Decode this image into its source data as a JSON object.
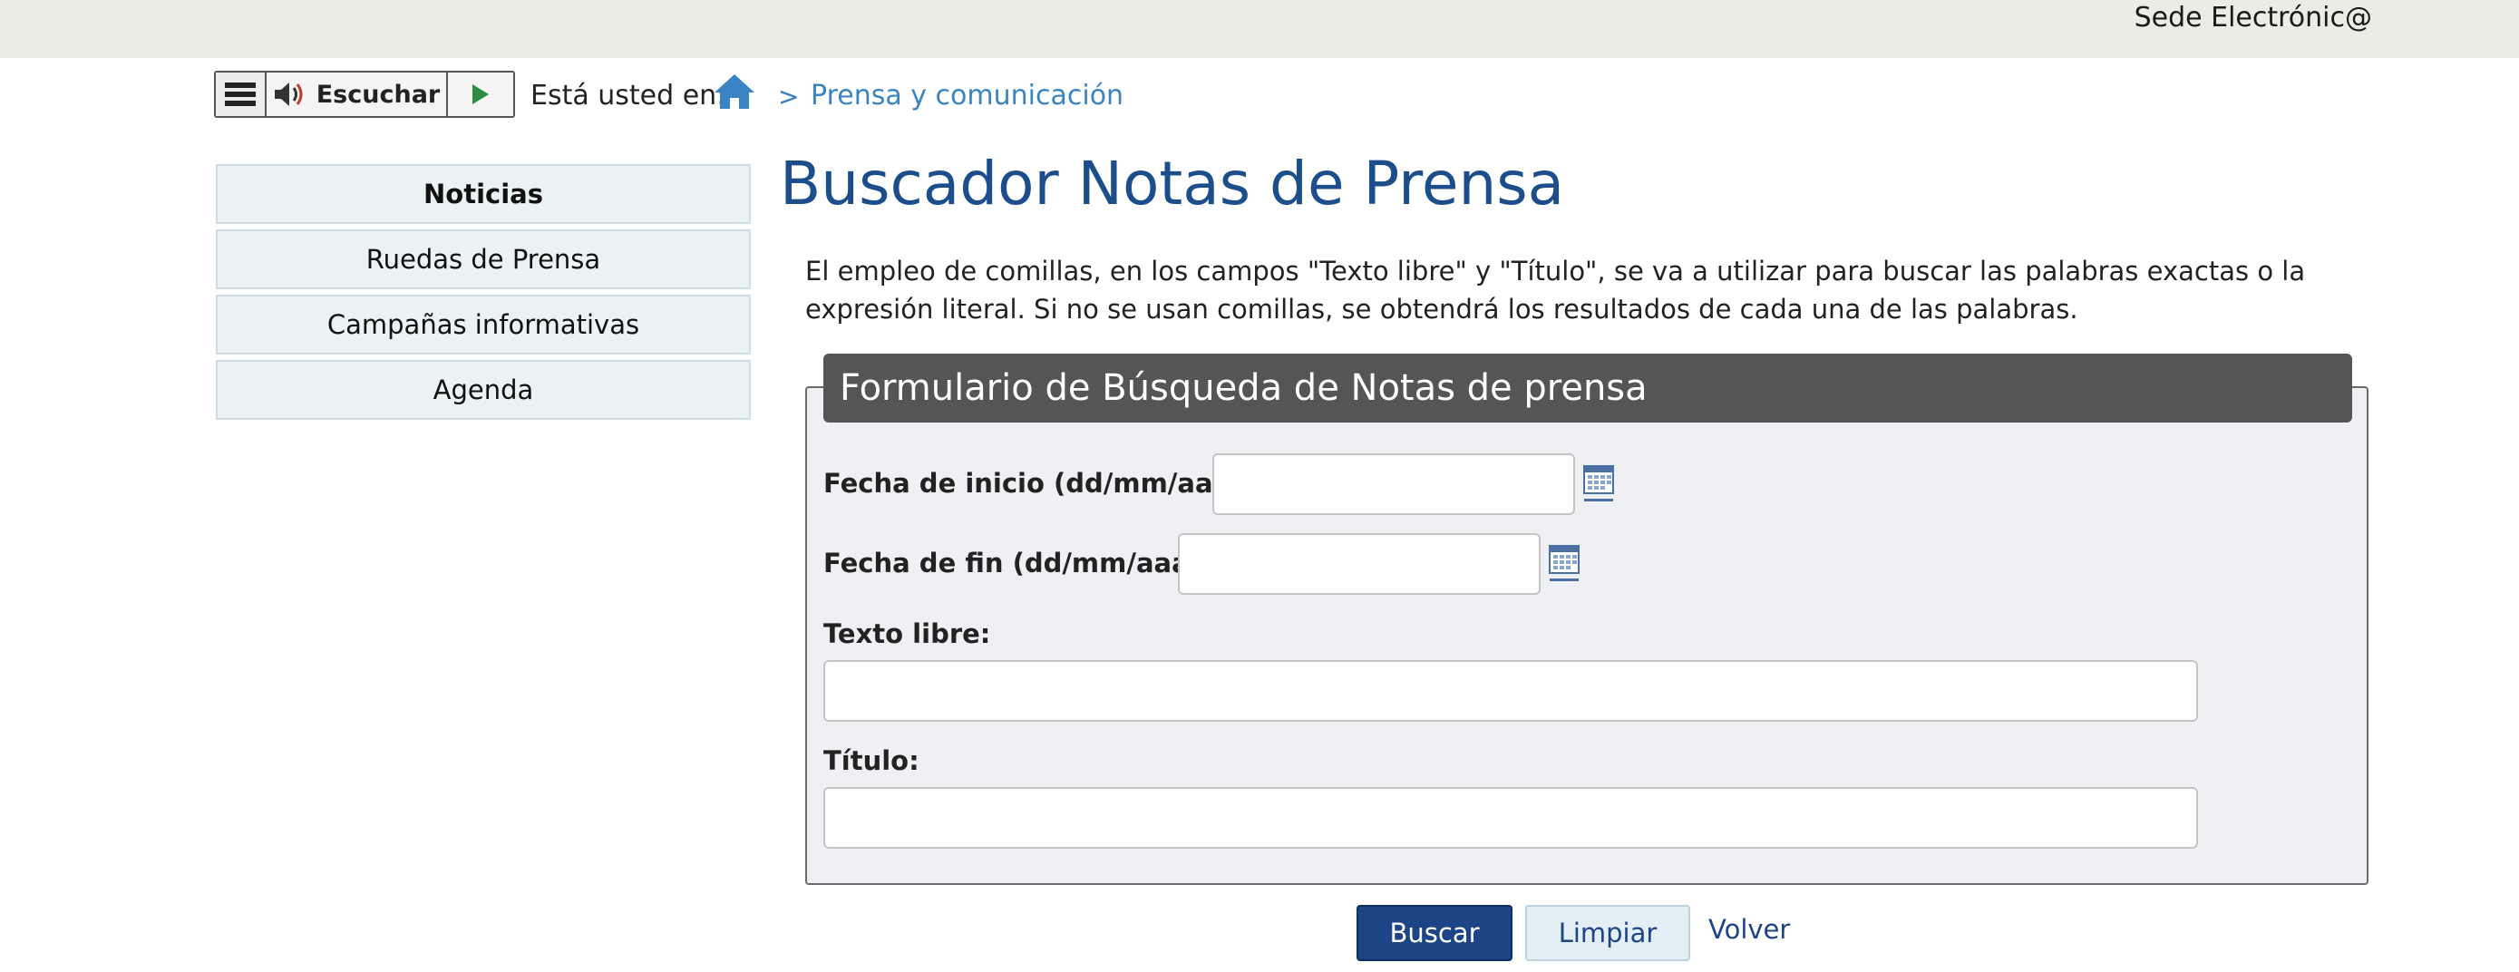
{
  "header": {
    "site_link": "Sede Electrónic@"
  },
  "player": {
    "listen_label": "Escuchar",
    "icons": [
      "menu-icon",
      "speaker-icon",
      "play-icon"
    ]
  },
  "breadcrumb": {
    "label": "Está usted en:",
    "separator": ">",
    "current": "Prensa y comunicación",
    "home_icon": "home-icon"
  },
  "sidebar": {
    "items": [
      {
        "label": "Noticias",
        "active": true
      },
      {
        "label": "Ruedas de Prensa",
        "active": false
      },
      {
        "label": "Campañas informativas",
        "active": false
      },
      {
        "label": "Agenda",
        "active": false
      }
    ]
  },
  "main": {
    "title": "Buscador Notas de Prensa",
    "intro": "El empleo de comillas, en los campos \"Texto libre\" y \"Título\", se va a utilizar para buscar las palabras exactas o la expresión literal. Si no se usan comillas, se obtendrá los resultados de cada una de las palabras."
  },
  "form": {
    "legend": "Formulario de Búsqueda de Notas de prensa",
    "fecha_inicio": {
      "label": "Fecha de inicio (dd/mm/aaaa):",
      "value": ""
    },
    "fecha_fin": {
      "label": "Fecha de fin (dd/mm/aaaa):",
      "value": ""
    },
    "texto_libre": {
      "label": "Texto libre:",
      "value": ""
    },
    "titulo": {
      "label": "Título:",
      "value": ""
    },
    "calendar_icon": "calendar-icon"
  },
  "actions": {
    "search": "Buscar",
    "clear": "Limpiar",
    "back": "Volver"
  },
  "colors": {
    "title": "#1d4e8c",
    "legend_bg": "#555555",
    "primary_button": "#1d4585",
    "link": "#3a84c4",
    "topbar": "#ecebe4"
  }
}
